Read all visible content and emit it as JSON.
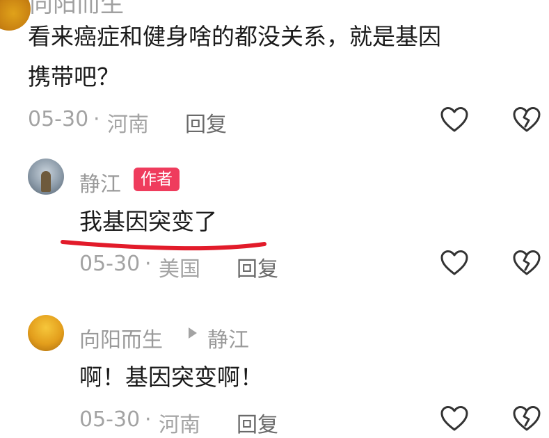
{
  "comment_top": {
    "username": "向阳而生",
    "text_line1": "看来癌症和健身啥的都没关系，就是基因",
    "text_line2": "携带吧？",
    "date": "05-30",
    "separator": "·",
    "location": "河南",
    "reply_label": "回复"
  },
  "reply_author": {
    "username": "静江",
    "badge": "作者",
    "text": "我基因突变了",
    "date": "05-30",
    "separator": "·",
    "location": "美国",
    "reply_label": "回复",
    "highlight_color": "#e21b2a"
  },
  "reply_third": {
    "username": "向阳而生",
    "reply_to": "静江",
    "text": "啊！基因突变啊！",
    "date": "05-30",
    "separator": "·",
    "location": "河南",
    "reply_label": "回复"
  },
  "icons": {
    "like": "heart-outline-icon",
    "dislike": "broken-heart-icon",
    "reply_arrow": "play-arrow-icon"
  }
}
